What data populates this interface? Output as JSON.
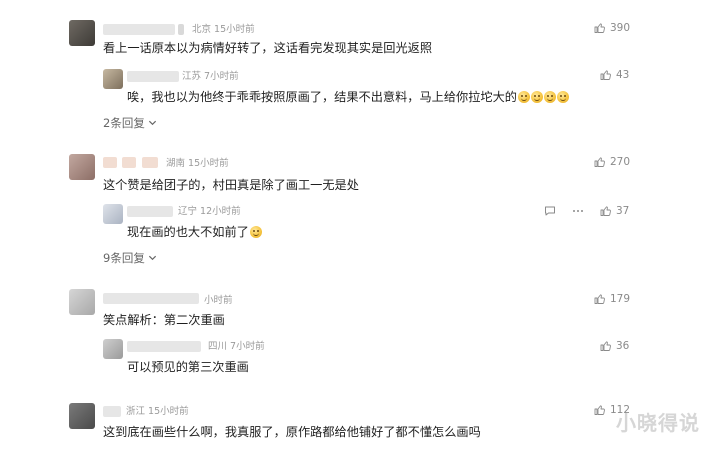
{
  "comments": [
    {
      "location": "北京",
      "time": "15小时前",
      "text": "看上一话原本以为病情好转了，这话看完发现其实是回光返照",
      "likes": "390",
      "reply": {
        "location": "江苏",
        "time": "7小时前",
        "text": "唉，我也以为他终于乖乖按照原画了，结果不出意料，马上给你拉坨大的",
        "likes": "43"
      },
      "more_replies": "2条回复"
    },
    {
      "location": "湖南",
      "time": "15小时前",
      "text": "这个赞是给团子的，村田真是除了画工一无是处",
      "likes": "270",
      "reply": {
        "location": "辽宁",
        "time": "12小时前",
        "text": "现在画的也大不如前了",
        "likes": "37"
      },
      "more_replies": "9条回复"
    },
    {
      "location": "",
      "time": "小时前",
      "text": "笑点解析：第二次重画",
      "likes": "179",
      "reply": {
        "location": "四川",
        "time": "7小时前",
        "text": "可以预见的第三次重画",
        "likes": "36"
      }
    },
    {
      "location": "浙江",
      "time": "15小时前",
      "text": "这到底在画些什么啊，我真服了，原作路都给他铺好了都不懂怎么画吗",
      "likes": "112"
    }
  ],
  "watermark": "小晓得说",
  "icons": {
    "like": "thumbs-up-icon",
    "comment": "comment-icon",
    "more": "more-dots-icon"
  }
}
